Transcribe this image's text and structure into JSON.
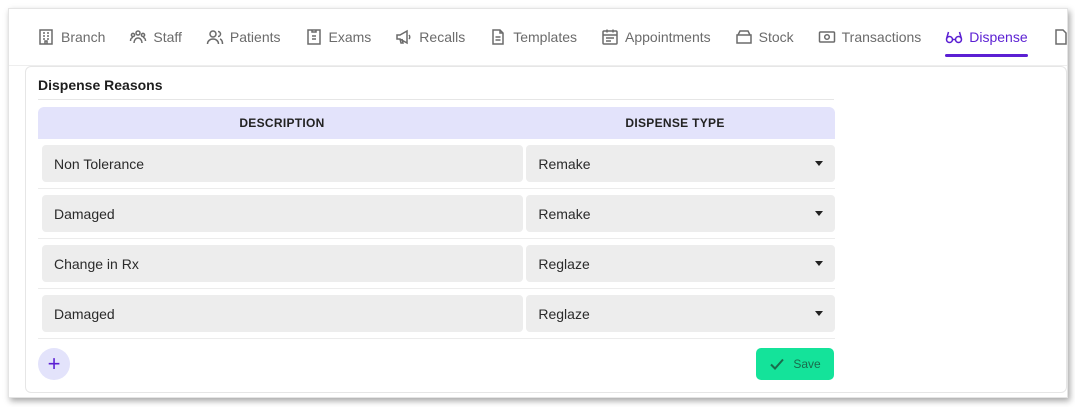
{
  "tabs": [
    {
      "label": "Branch",
      "icon": "building-icon"
    },
    {
      "label": "Staff",
      "icon": "staff-icon"
    },
    {
      "label": "Patients",
      "icon": "users-icon"
    },
    {
      "label": "Exams",
      "icon": "exam-icon"
    },
    {
      "label": "Recalls",
      "icon": "megaphone-icon"
    },
    {
      "label": "Templates",
      "icon": "document-icon"
    },
    {
      "label": "Appointments",
      "icon": "calendar-icon"
    },
    {
      "label": "Stock",
      "icon": "box-icon"
    },
    {
      "label": "Transactions",
      "icon": "money-icon"
    },
    {
      "label": "Dispense",
      "icon": "glasses-icon",
      "active": true
    }
  ],
  "section": {
    "title": "Dispense Reasons"
  },
  "table": {
    "headers": [
      "DESCRIPTION",
      "DISPENSE TYPE"
    ],
    "rows": [
      {
        "description": "Non Tolerance",
        "type": "Remake"
      },
      {
        "description": "Damaged",
        "type": "Remake"
      },
      {
        "description": "Change in Rx",
        "type": "Reglaze"
      },
      {
        "description": "Damaged",
        "type": "Reglaze"
      }
    ]
  },
  "actions": {
    "add_symbol": "+",
    "save_label": "Save"
  },
  "colors": {
    "accent": "#5b1fd3",
    "header_bg": "#e3e3fb",
    "save_bg": "#14e39a"
  }
}
